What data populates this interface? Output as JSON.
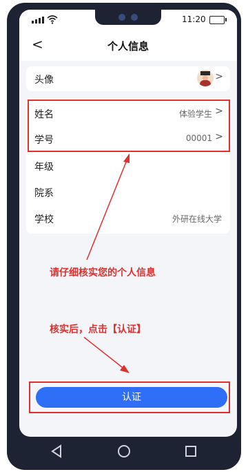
{
  "status_bar": {
    "time": "11:20"
  },
  "header": {
    "title": "个人信息",
    "back_label": "<"
  },
  "profile": {
    "avatar_label": "头像",
    "rows": [
      {
        "label": "姓名",
        "value": "体验学生"
      },
      {
        "label": "学号",
        "value": "00001"
      },
      {
        "label": "年级",
        "value": ""
      },
      {
        "label": "院系",
        "value": ""
      },
      {
        "label": "学校",
        "value": "外研在线大学"
      }
    ]
  },
  "annotations": {
    "check_info": "请仔细核实您的个人信息",
    "after_check": "核实后，点击【认证】"
  },
  "verify_button": {
    "label": "认证"
  },
  "chevron": ">",
  "colors": {
    "accent": "#2f6ef6",
    "annotation": "#e0302d"
  },
  "icons": [
    "signal-icon",
    "wifi-icon",
    "battery-icon",
    "back-icon",
    "chevron-right-icon",
    "avatar-icon",
    "nav-back-icon",
    "nav-home-icon",
    "nav-recent-icon"
  ]
}
